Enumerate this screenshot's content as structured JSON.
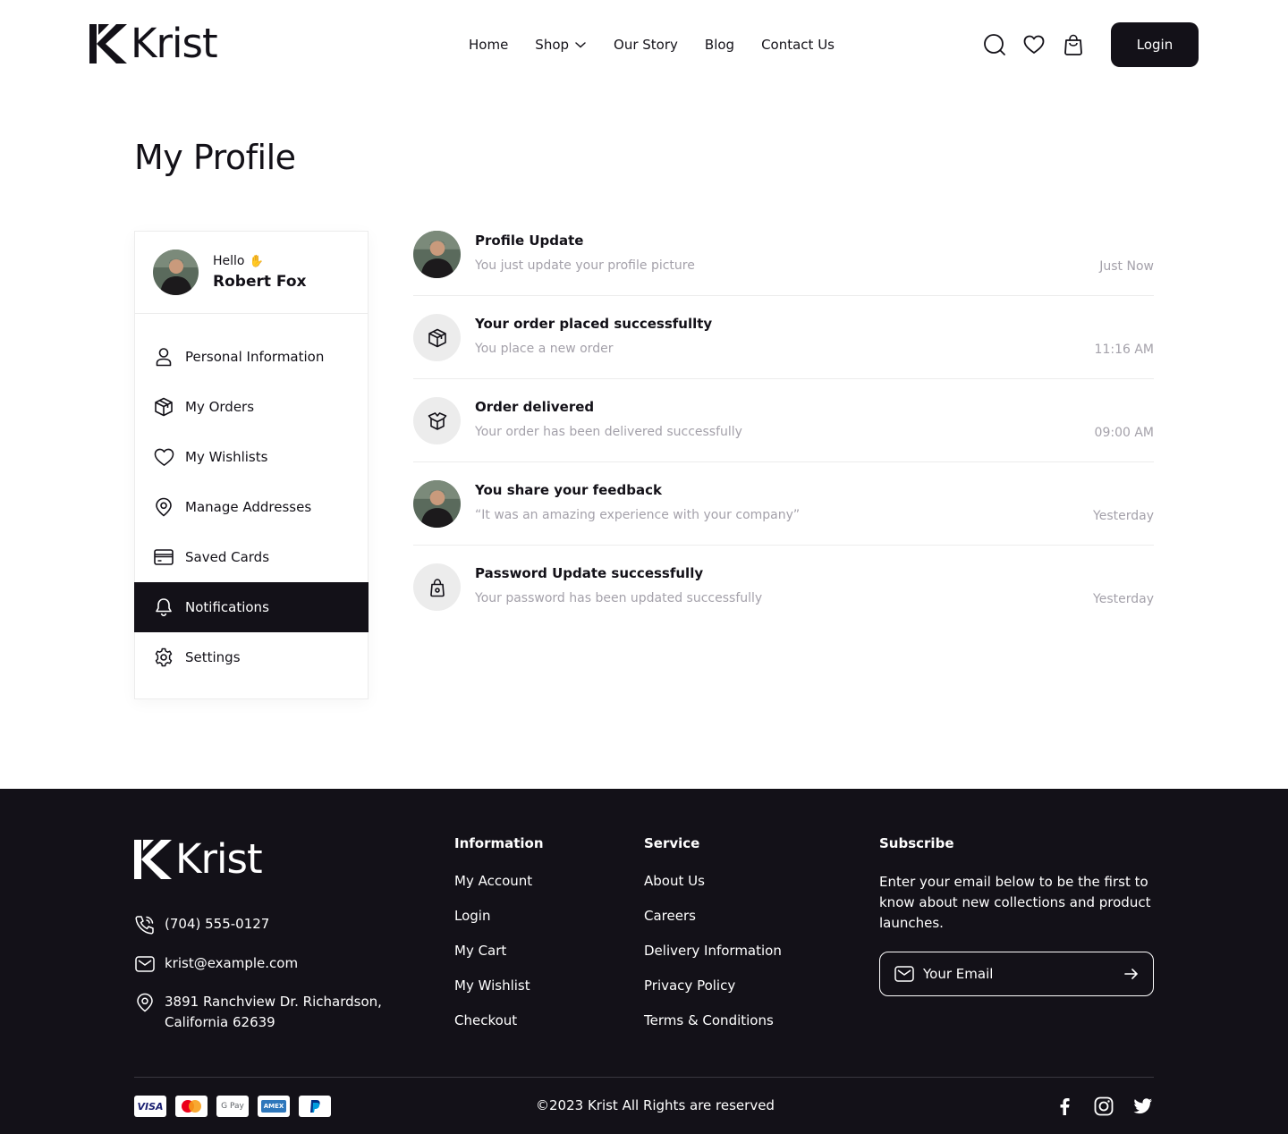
{
  "brand": {
    "name": "Krist"
  },
  "nav": {
    "items": [
      {
        "label": "Home"
      },
      {
        "label": "Shop"
      },
      {
        "label": "Our Story"
      },
      {
        "label": "Blog"
      },
      {
        "label": "Contact Us"
      }
    ],
    "login_label": "Login"
  },
  "page": {
    "title": "My Profile"
  },
  "user": {
    "greeting": "Hello",
    "name": "Robert Fox"
  },
  "sidebar": {
    "items": [
      {
        "label": "Personal Information",
        "icon": "user-icon"
      },
      {
        "label": "My Orders",
        "icon": "box-icon"
      },
      {
        "label": "My Wishlists",
        "icon": "heart-icon"
      },
      {
        "label": "Manage Addresses",
        "icon": "location-icon"
      },
      {
        "label": "Saved Cards",
        "icon": "card-icon"
      },
      {
        "label": "Notifications",
        "icon": "bell-icon",
        "active": true
      },
      {
        "label": "Settings",
        "icon": "gear-icon"
      }
    ]
  },
  "notifications": [
    {
      "title": "Profile Update",
      "desc": "You just update your profile picture",
      "time": "Just Now",
      "icon": "avatar"
    },
    {
      "title": "Your order placed successfullty",
      "desc": "You place a new order",
      "time": "11:16 AM",
      "icon": "box-icon"
    },
    {
      "title": "Order delivered",
      "desc": "Your order has been delivered successfully",
      "time": "09:00 AM",
      "icon": "open-box-icon"
    },
    {
      "title": "You share your feedback",
      "desc": "“It was an amazing experience with your company”",
      "time": "Yesterday",
      "icon": "avatar"
    },
    {
      "title": "Password Update successfully",
      "desc": "Your password has been updated successfully",
      "time": "Yesterday",
      "icon": "lock-icon"
    }
  ],
  "footer": {
    "phone": "(704) 555-0127",
    "email": "krist@example.com",
    "address_line1": "3891 Ranchview Dr. Richardson,",
    "address_line2": "California 62639",
    "information": {
      "title": "Information",
      "links": [
        "My Account",
        "Login",
        "My Cart",
        "My Wishlist",
        "Checkout"
      ]
    },
    "service": {
      "title": "Service",
      "links": [
        "About Us",
        "Careers",
        "Delivery Information",
        "Privacy Policy",
        "Terms & Conditions"
      ]
    },
    "subscribe": {
      "title": "Subscribe",
      "text": "Enter your email below to be the first to know about new collections and product launches.",
      "placeholder": "Your Email"
    },
    "payments": [
      "VISA",
      "mastercard",
      "G Pay",
      "AMEX",
      "PayPal"
    ],
    "copyright": "©2023 Krist All Rights are reserved",
    "socials": [
      "facebook-icon",
      "instagram-icon",
      "twitter-icon"
    ]
  },
  "colors": {
    "dark": "#131118",
    "muted": "#A4A1AA",
    "border": "#ECECEC"
  }
}
